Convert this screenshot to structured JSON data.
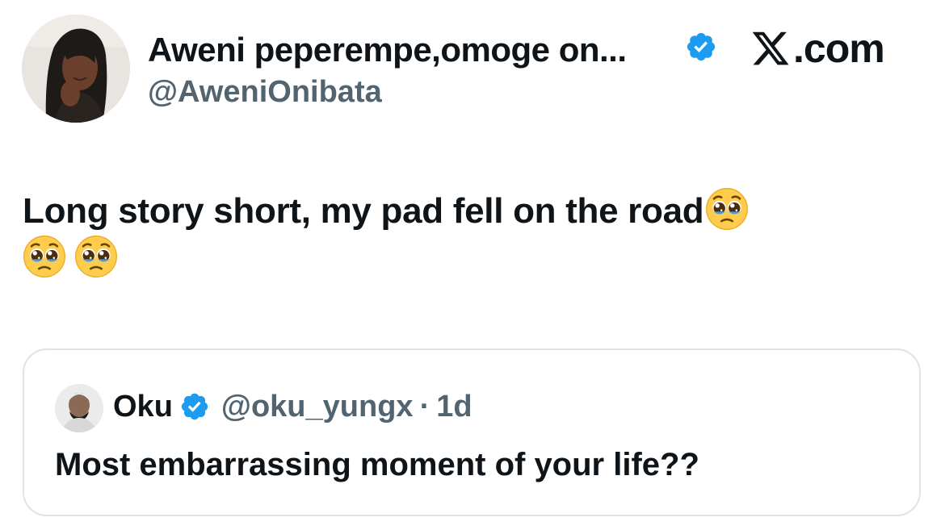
{
  "post": {
    "display_name": "Aweni peperempe,omoge on...",
    "handle": "@AweniOnibata",
    "verified": true,
    "text": "Long story short, my pad fell on the road",
    "emoji": "pleading-face",
    "emoji_count": 3
  },
  "brand": {
    "text": ".com",
    "icon": "x-logo-icon"
  },
  "quoted": {
    "display_name": "Oku",
    "handle": "@oku_yungx",
    "separator": "·",
    "time": "1d",
    "verified": true,
    "text": "Most embarrassing moment of your life??"
  },
  "colors": {
    "verified_blue": "#1d9bf0",
    "muted_text": "#536471",
    "primary_text": "#0f1419",
    "border": "#dfe3e7"
  }
}
